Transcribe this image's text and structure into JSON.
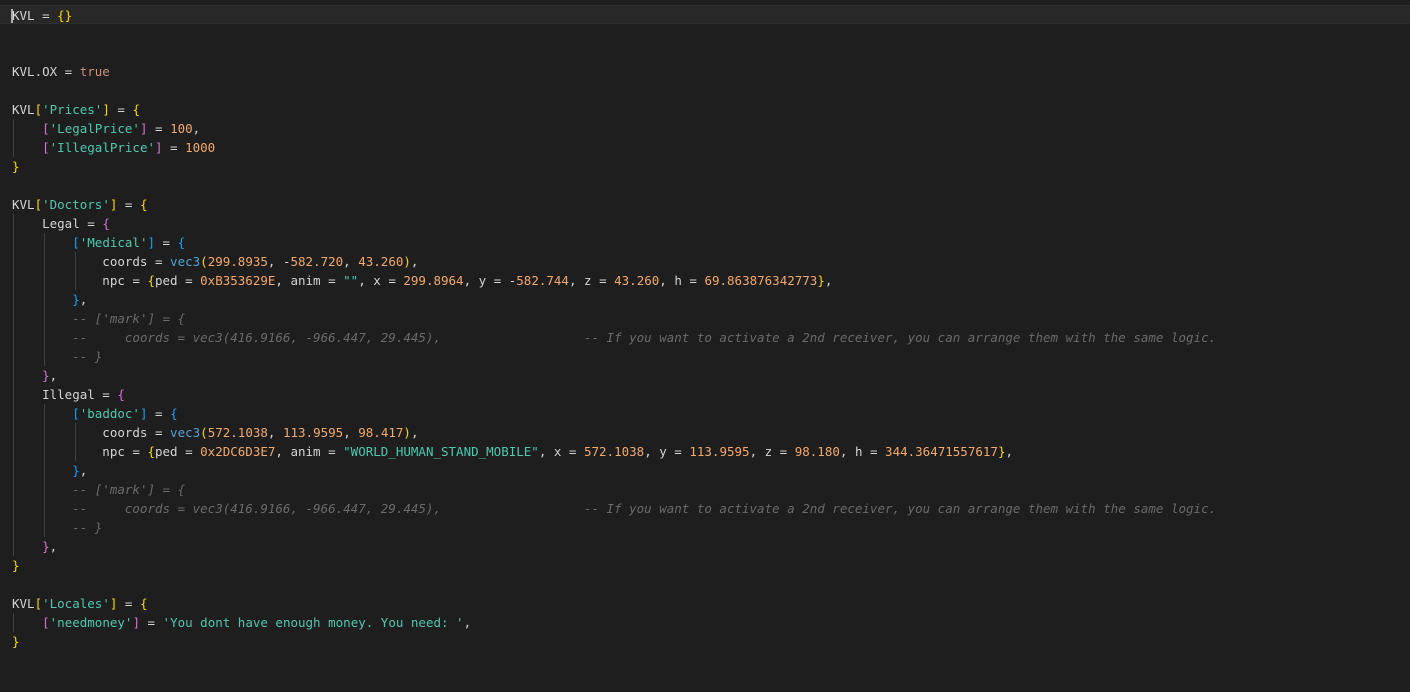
{
  "editor": {
    "language": "lua",
    "lines": [
      [
        [
          "plain",
          "KVL = "
        ],
        [
          "b1",
          "{}"
        ]
      ],
      [],
      [],
      [
        [
          "plain",
          "KVL.OX = "
        ],
        [
          "kw",
          "true"
        ]
      ],
      [],
      [
        [
          "plain",
          "KVL"
        ],
        [
          "b1",
          "["
        ],
        [
          "str",
          "'Prices'"
        ],
        [
          "b1",
          "]"
        ],
        [
          "plain",
          " = "
        ],
        [
          "b1",
          "{"
        ]
      ],
      [
        [
          "plain",
          "    "
        ],
        [
          "b2",
          "["
        ],
        [
          "str",
          "'LegalPrice'"
        ],
        [
          "b2",
          "]"
        ],
        [
          "plain",
          " = "
        ],
        [
          "num",
          "100"
        ],
        [
          "plain",
          ","
        ]
      ],
      [
        [
          "plain",
          "    "
        ],
        [
          "b2",
          "["
        ],
        [
          "str",
          "'IllegalPrice'"
        ],
        [
          "b2",
          "]"
        ],
        [
          "plain",
          " = "
        ],
        [
          "num",
          "1000"
        ]
      ],
      [
        [
          "b1",
          "}"
        ]
      ],
      [],
      [
        [
          "plain",
          "KVL"
        ],
        [
          "b1",
          "["
        ],
        [
          "str",
          "'Doctors'"
        ],
        [
          "b1",
          "]"
        ],
        [
          "plain",
          " = "
        ],
        [
          "b1",
          "{"
        ]
      ],
      [
        [
          "plain",
          "    Legal = "
        ],
        [
          "b2",
          "{"
        ]
      ],
      [
        [
          "plain",
          "        "
        ],
        [
          "b3",
          "["
        ],
        [
          "str",
          "'Medical'"
        ],
        [
          "b3",
          "]"
        ],
        [
          "plain",
          " = "
        ],
        [
          "b3",
          "{"
        ]
      ],
      [
        [
          "plain",
          "            coords = "
        ],
        [
          "func",
          "vec3"
        ],
        [
          "b1",
          "("
        ],
        [
          "num",
          "299.8935"
        ],
        [
          "plain",
          ", -"
        ],
        [
          "num",
          "582.720"
        ],
        [
          "plain",
          ", "
        ],
        [
          "num",
          "43.260"
        ],
        [
          "b1",
          ")"
        ],
        [
          "plain",
          ","
        ]
      ],
      [
        [
          "plain",
          "            npc = "
        ],
        [
          "b1",
          "{"
        ],
        [
          "plain",
          "ped = "
        ],
        [
          "num",
          "0xB353629E"
        ],
        [
          "plain",
          ", anim = "
        ],
        [
          "str",
          "\"\""
        ],
        [
          "plain",
          ", x = "
        ],
        [
          "num",
          "299.8964"
        ],
        [
          "plain",
          ", y = -"
        ],
        [
          "num",
          "582.744"
        ],
        [
          "plain",
          ", z = "
        ],
        [
          "num",
          "43.260"
        ],
        [
          "plain",
          ", h = "
        ],
        [
          "num",
          "69.863876342773"
        ],
        [
          "b1",
          "}"
        ],
        [
          "plain",
          ","
        ]
      ],
      [
        [
          "plain",
          "        "
        ],
        [
          "b3",
          "}"
        ],
        [
          "plain",
          ","
        ]
      ],
      [
        [
          "plain",
          "        "
        ],
        [
          "cmt",
          "-- ['mark'] = {"
        ]
      ],
      [
        [
          "plain",
          "        "
        ],
        [
          "cmt",
          "--     coords = vec3(416.9166, -966.447, 29.445),                   -- If you want to activate a 2nd receiver, you can arrange them with the same logic."
        ]
      ],
      [
        [
          "plain",
          "        "
        ],
        [
          "cmt",
          "-- }"
        ]
      ],
      [
        [
          "plain",
          "    "
        ],
        [
          "b2",
          "}"
        ],
        [
          "plain",
          ","
        ]
      ],
      [
        [
          "plain",
          "    Illegal = "
        ],
        [
          "b2",
          "{"
        ]
      ],
      [
        [
          "plain",
          "        "
        ],
        [
          "b3",
          "["
        ],
        [
          "str",
          "'baddoc'"
        ],
        [
          "b3",
          "]"
        ],
        [
          "plain",
          " = "
        ],
        [
          "b3",
          "{"
        ]
      ],
      [
        [
          "plain",
          "            coords = "
        ],
        [
          "func",
          "vec3"
        ],
        [
          "b1",
          "("
        ],
        [
          "num",
          "572.1038"
        ],
        [
          "plain",
          ", "
        ],
        [
          "num",
          "113.9595"
        ],
        [
          "plain",
          ", "
        ],
        [
          "num",
          "98.417"
        ],
        [
          "b1",
          ")"
        ],
        [
          "plain",
          ","
        ]
      ],
      [
        [
          "plain",
          "            npc = "
        ],
        [
          "b1",
          "{"
        ],
        [
          "plain",
          "ped = "
        ],
        [
          "num",
          "0x2DC6D3E7"
        ],
        [
          "plain",
          ", anim = "
        ],
        [
          "str",
          "\"WORLD_HUMAN_STAND_MOBILE\""
        ],
        [
          "plain",
          ", x = "
        ],
        [
          "num",
          "572.1038"
        ],
        [
          "plain",
          ", y = "
        ],
        [
          "num",
          "113.9595"
        ],
        [
          "plain",
          ", z = "
        ],
        [
          "num",
          "98.180"
        ],
        [
          "plain",
          ", h = "
        ],
        [
          "num",
          "344.36471557617"
        ],
        [
          "b1",
          "}"
        ],
        [
          "plain",
          ","
        ]
      ],
      [
        [
          "plain",
          "        "
        ],
        [
          "b3",
          "}"
        ],
        [
          "plain",
          ","
        ]
      ],
      [
        [
          "plain",
          "        "
        ],
        [
          "cmt",
          "-- ['mark'] = {"
        ]
      ],
      [
        [
          "plain",
          "        "
        ],
        [
          "cmt",
          "--     coords = vec3(416.9166, -966.447, 29.445),                   -- If you want to activate a 2nd receiver, you can arrange them with the same logic."
        ]
      ],
      [
        [
          "plain",
          "        "
        ],
        [
          "cmt",
          "-- }"
        ]
      ],
      [
        [
          "plain",
          "    "
        ],
        [
          "b2",
          "}"
        ],
        [
          "plain",
          ","
        ]
      ],
      [
        [
          "b1",
          "}"
        ]
      ],
      [],
      [
        [
          "plain",
          "KVL"
        ],
        [
          "b1",
          "["
        ],
        [
          "str",
          "'Locales'"
        ],
        [
          "b1",
          "]"
        ],
        [
          "plain",
          " = "
        ],
        [
          "b1",
          "{"
        ]
      ],
      [
        [
          "plain",
          "    "
        ],
        [
          "b2",
          "["
        ],
        [
          "str",
          "'needmoney'"
        ],
        [
          "b2",
          "]"
        ],
        [
          "plain",
          " = "
        ],
        [
          "str",
          "'You dont have enough money. You need: '"
        ],
        [
          "plain",
          ","
        ]
      ],
      [
        [
          "b1",
          "}"
        ]
      ]
    ]
  }
}
